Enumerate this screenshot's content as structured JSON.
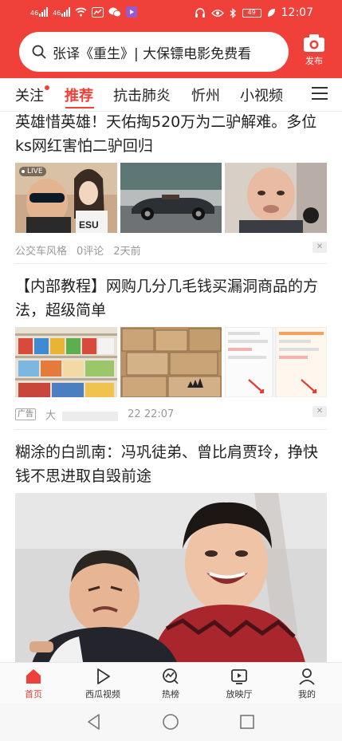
{
  "status_bar": {
    "network_left": "46",
    "network_right": "46",
    "battery": "49",
    "time": "12:07"
  },
  "search": {
    "icon": "search-icon",
    "text": "张译《重生》| 大保镖电影免费看"
  },
  "publish": {
    "icon": "camera-icon",
    "label": "发布"
  },
  "tabs": [
    {
      "label": "关注",
      "badge": true
    },
    {
      "label": "推荐",
      "active": true
    },
    {
      "label": "抗击肺炎"
    },
    {
      "label": "忻州"
    },
    {
      "label": "小视频"
    }
  ],
  "articles": [
    {
      "title": "英雄惜英雄！天佑掏520万为二驴解难。多位ks网红害怕二驴回归",
      "images": [
        "live-selfie-photo",
        "convertible-car-photo",
        "man-portrait-photo"
      ],
      "live_badge": "LIVE",
      "source": "公交车风格",
      "comments": "0评论",
      "time": "2天前"
    },
    {
      "title": "【内部教程】网购几分几毛钱买漏洞商品的方法，超级简单",
      "images": [
        "store-shelves-photo",
        "cardboard-boxes-photo",
        "phone-screenshot-photo"
      ],
      "ad_label": "广告",
      "source": "大",
      "time": "22 22:07"
    },
    {
      "title": "糊涂的白凯南：冯巩徒弟、曾比肩贾玲，挣快钱不思进取自毁前途",
      "image": "two-people-laughing-photo"
    }
  ],
  "bottom_nav": [
    {
      "label": "首页",
      "icon": "home-icon",
      "active": true
    },
    {
      "label": "西瓜视频",
      "icon": "play-icon"
    },
    {
      "label": "热榜",
      "icon": "trending-icon"
    },
    {
      "label": "放映厅",
      "icon": "tv-icon"
    },
    {
      "label": "我的",
      "icon": "profile-icon"
    }
  ],
  "system_nav": [
    "back-icon",
    "home-circle-icon",
    "recents-icon"
  ],
  "colors": {
    "brand_red": "#f0403a"
  }
}
